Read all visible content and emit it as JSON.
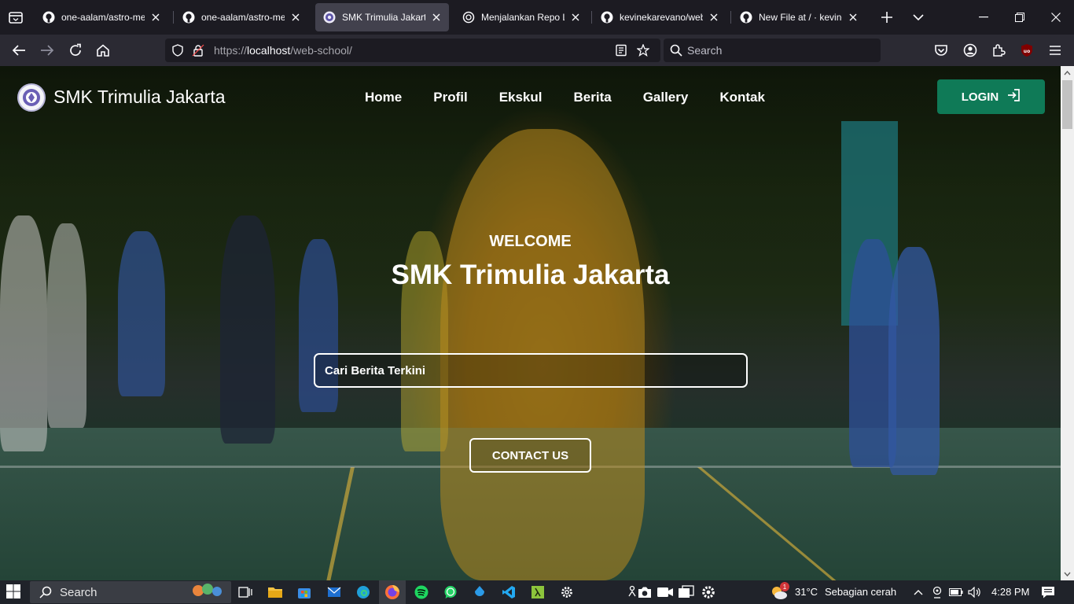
{
  "browser": {
    "tabs": [
      {
        "title": "one-aalam/astro-me",
        "icon": "github-icon",
        "active": false
      },
      {
        "title": "one-aalam/astro-me",
        "icon": "github-icon",
        "active": false
      },
      {
        "title": "SMK Trimulia Jakarta",
        "icon": "school-logo-icon",
        "active": true
      },
      {
        "title": "Menjalankan Repo Lok",
        "icon": "openai-icon",
        "active": false
      },
      {
        "title": "kevinekarevano/web-s",
        "icon": "github-icon",
        "active": false
      },
      {
        "title": "New File at / · kevineka",
        "icon": "github-icon",
        "active": false
      }
    ],
    "url_scheme": "https://",
    "url_host": "localhost",
    "url_path": "/web-school/",
    "search_placeholder": "Search"
  },
  "site": {
    "name": "SMK Trimulia Jakarta",
    "nav": [
      "Home",
      "Profil",
      "Ekskul",
      "Berita",
      "Gallery",
      "Kontak"
    ],
    "login_label": "LOGIN",
    "hero": {
      "welcome": "WELCOME",
      "title": "SMK Trimulia Jakarta",
      "search_placeholder": "Cari Berita Terkini",
      "contact_label": "CONTACT US"
    }
  },
  "taskbar": {
    "search_label": "Search",
    "weather_temp": "31°C",
    "weather_desc": "Sebagian cerah",
    "notification_count": "1",
    "time": "4:28 PM"
  },
  "colors": {
    "login_button": "#0f7a57",
    "browser_bg": "#1c1b22",
    "navbar_bg": "#2b2a33"
  }
}
